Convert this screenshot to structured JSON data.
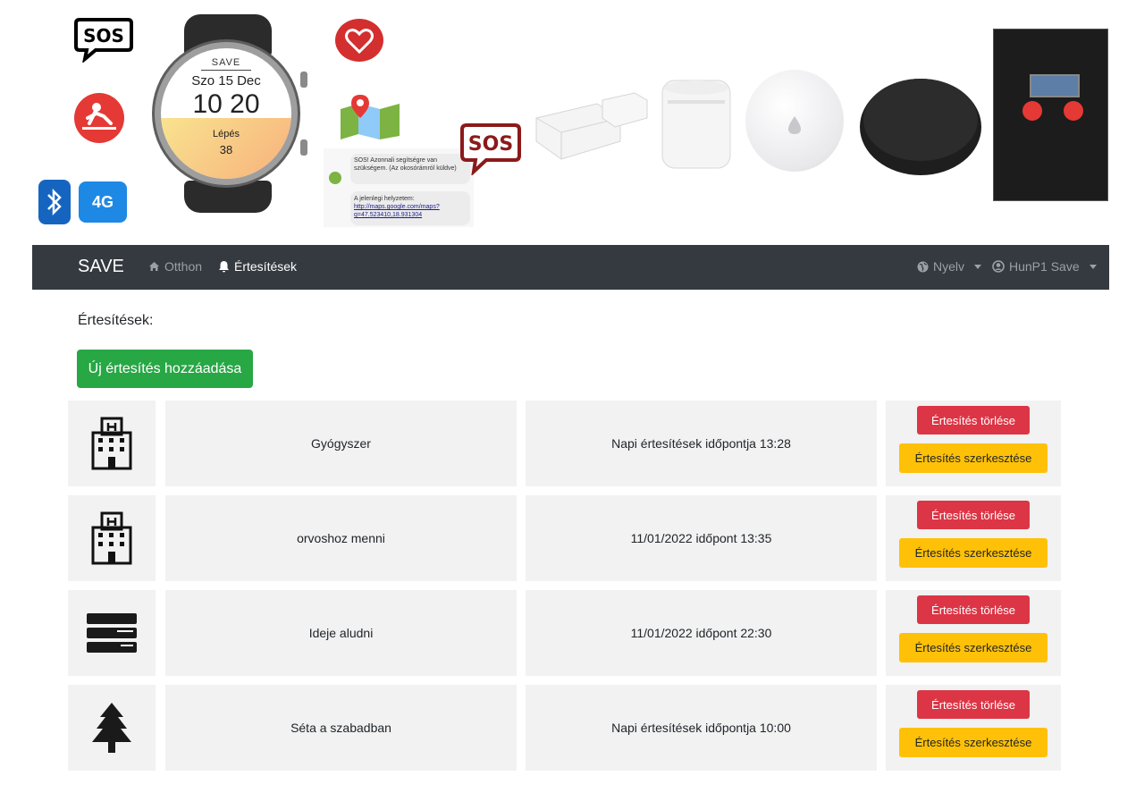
{
  "banner": {
    "sos_label": "SOS",
    "watch": {
      "brand": "SAVE",
      "date": "Szo 15 Dec",
      "time": "10 20",
      "steps_label": "Lépés",
      "steps_value": "38"
    },
    "lte_label": "4G",
    "sms": {
      "message_1": "SOS! Azonnali segítségre van szükségem. (Az okosórámról küldve)",
      "message_2_label": "A jelenlegi helyzetem:",
      "message_2_link": "http://maps.google.com/maps?q=47.523410,18.931304"
    }
  },
  "navbar": {
    "brand": "SAVE",
    "home_label": "Otthon",
    "notifications_label": "Értesítések",
    "language_label": "Nyelv",
    "user_label": "HunP1 Save"
  },
  "page": {
    "heading": "Értesítések:",
    "add_button": "Új értesítés hozzáadása"
  },
  "notifications": [
    {
      "icon": "hospital-icon",
      "name": "Gyógyszer",
      "time": "Napi értesítések időpontja 13:28",
      "delete_label": "Értesítés törlése",
      "edit_label": "Értesítés szerkesztése"
    },
    {
      "icon": "hospital-icon",
      "name": "orvoshoz menni",
      "time": "11/01/2022 időpont 13:35",
      "delete_label": "Értesítés törlése",
      "edit_label": "Értesítés szerkesztése"
    },
    {
      "icon": "bed-icon",
      "name": "Ideje aludni",
      "time": "11/01/2022 időpont 22:30",
      "delete_label": "Értesítés törlése",
      "edit_label": "Értesítés szerkesztése"
    },
    {
      "icon": "tree-icon",
      "name": "Séta a szabadban",
      "time": "Napi értesítések időpontja 10:00",
      "delete_label": "Értesítés törlése",
      "edit_label": "Értesítés szerkesztése"
    }
  ],
  "colors": {
    "navbar": "#343a40",
    "success": "#28a745",
    "danger": "#dc3545",
    "warning": "#ffc107",
    "cell_bg": "#f2f2f2"
  }
}
